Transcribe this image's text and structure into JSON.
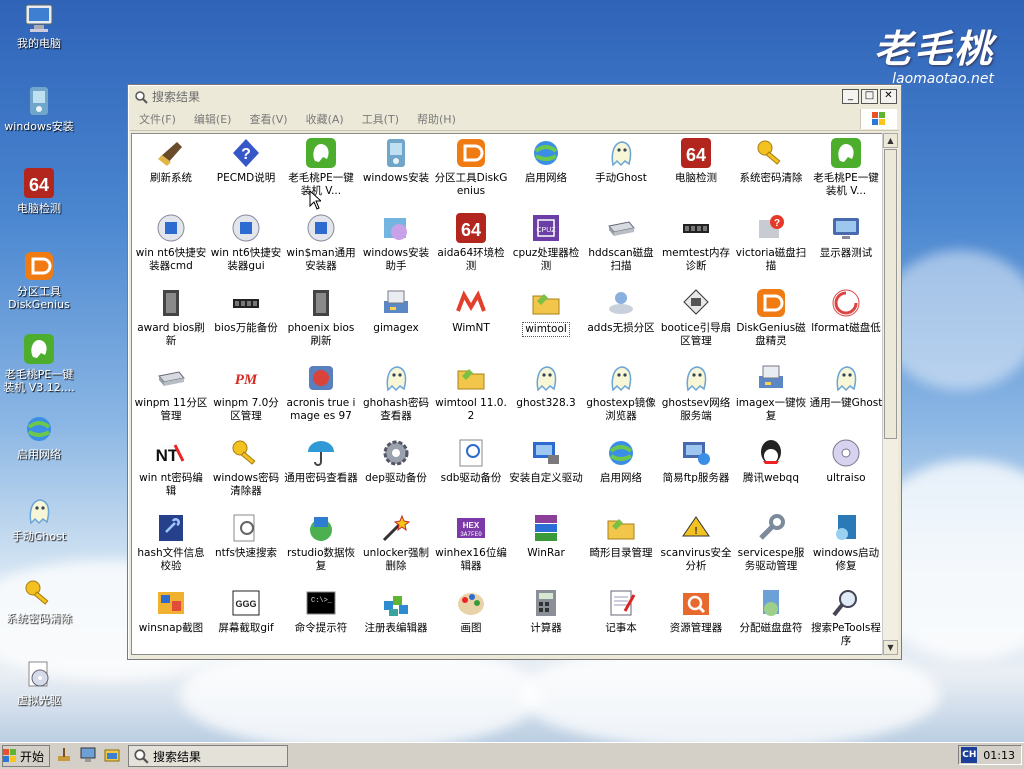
{
  "brand": {
    "name": "老毛桃",
    "url": "laomaotao.net"
  },
  "desktop_icons": [
    {
      "label": "我的电脑",
      "icon": "computer-icon"
    },
    {
      "label": "windows安装",
      "icon": "windows-install-icon"
    },
    {
      "label": "电脑检测",
      "icon": "64-icon"
    },
    {
      "label": "分区工具\nDiskGenius",
      "icon": "diskgenius-icon"
    },
    {
      "label": "老毛桃PE一键\n装机 V3.12....",
      "icon": "laomaotao-icon"
    },
    {
      "label": "启用网络",
      "icon": "network-icon"
    },
    {
      "label": "手动Ghost",
      "icon": "ghost-icon"
    },
    {
      "label": "系统密码清除",
      "icon": "key-icon"
    },
    {
      "label": "虚拟光驱",
      "icon": "virtual-drive-icon"
    }
  ],
  "window": {
    "title": "搜索结果",
    "menu": [
      "文件(F)",
      "编辑(E)",
      "查看(V)",
      "收藏(A)",
      "工具(T)",
      "帮助(H)"
    ],
    "items": [
      {
        "label": "刷新系统",
        "icon": "broom-icon"
      },
      {
        "label": "PECMD说明",
        "icon": "help-icon"
      },
      {
        "label": "老毛桃PE一键装机 V...",
        "icon": "laomaotao-icon"
      },
      {
        "label": "windows安装",
        "icon": "windows-install-icon"
      },
      {
        "label": "分区工具DiskGenius",
        "icon": "diskgenius-icon"
      },
      {
        "label": "启用网络",
        "icon": "network-icon"
      },
      {
        "label": "手动Ghost",
        "icon": "ghost-icon"
      },
      {
        "label": "电脑检测",
        "icon": "64-icon"
      },
      {
        "label": "系统密码清除",
        "icon": "key-icon"
      },
      {
        "label": "老毛桃PE一键装机 V...",
        "icon": "laomaotao-icon"
      },
      {
        "label": "win nt6快捷安装器cmd",
        "icon": "install-cmd-icon"
      },
      {
        "label": "win nt6快捷安装器gui",
        "icon": "install-gui-icon"
      },
      {
        "label": "win$man通用安装器",
        "icon": "winsman-icon"
      },
      {
        "label": "windows安装助手",
        "icon": "install-helper-icon"
      },
      {
        "label": "aida64环境检测",
        "icon": "64-icon"
      },
      {
        "label": "cpuz处理器检测",
        "icon": "cpuz-icon"
      },
      {
        "label": "hddscan磁盘扫描",
        "icon": "hdd-icon"
      },
      {
        "label": "memtest内存诊断",
        "icon": "memory-icon"
      },
      {
        "label": "victoria磁盘扫描",
        "icon": "victoria-icon"
      },
      {
        "label": "显示器测试",
        "icon": "monitor-icon"
      },
      {
        "label": "award bios刷新",
        "icon": "bios-icon"
      },
      {
        "label": "bios万能备份",
        "icon": "chip-icon"
      },
      {
        "label": "phoenix bios刷新",
        "icon": "bios-icon"
      },
      {
        "label": "gimagex",
        "icon": "gimagex-icon"
      },
      {
        "label": "WimNT",
        "icon": "wimnt-icon"
      },
      {
        "label": "wimtool",
        "icon": "folder-icon"
      },
      {
        "label": "adds无损分区",
        "icon": "partition-icon"
      },
      {
        "label": "bootice引导扇区管理",
        "icon": "bootice-icon"
      },
      {
        "label": "DiskGenius磁盘精灵",
        "icon": "diskgenius-icon"
      },
      {
        "label": "lformat磁盘低",
        "icon": "lformat-icon"
      },
      {
        "label": "winpm 11分区管理",
        "icon": "drive-icon"
      },
      {
        "label": "winpm 7.0分区管理",
        "icon": "pm-icon"
      },
      {
        "label": "acronis true image es 97",
        "icon": "acronis-icon"
      },
      {
        "label": "ghohash密码查看器",
        "icon": "ghost-icon"
      },
      {
        "label": "wimtool 11.0.2",
        "icon": "folder-icon"
      },
      {
        "label": "ghost328.3",
        "icon": "ghost-icon"
      },
      {
        "label": "ghostexp镜像浏览器",
        "icon": "ghost-icon"
      },
      {
        "label": "ghostsev网络服务端",
        "icon": "ghost-icon"
      },
      {
        "label": "imagex一键恢复",
        "icon": "imagex-icon"
      },
      {
        "label": "通用一键Ghost",
        "icon": "ghost-icon"
      },
      {
        "label": "win nt密码编辑",
        "icon": "nt-icon"
      },
      {
        "label": "windows密码清除器",
        "icon": "key-icon"
      },
      {
        "label": "通用密码查看器",
        "icon": "umbrella-icon"
      },
      {
        "label": "dep驱动备份",
        "icon": "gear-icon"
      },
      {
        "label": "sdb驱动备份",
        "icon": "sdb-icon"
      },
      {
        "label": "安装自定义驱动",
        "icon": "driver-icon"
      },
      {
        "label": "启用网络",
        "icon": "network-icon"
      },
      {
        "label": "简易ftp服务器",
        "icon": "ftp-icon"
      },
      {
        "label": "腾讯webqq",
        "icon": "qq-icon"
      },
      {
        "label": "ultraiso",
        "icon": "cd-icon"
      },
      {
        "label": "hash文件信息校验",
        "icon": "hash-icon"
      },
      {
        "label": "ntfs快速搜索",
        "icon": "search-doc-icon"
      },
      {
        "label": "rstudio数据恢复",
        "icon": "rstudio-icon"
      },
      {
        "label": "unlocker强制删除",
        "icon": "wand-icon"
      },
      {
        "label": "winhex16位编辑器",
        "icon": "hex-icon"
      },
      {
        "label": "WinRar",
        "icon": "winrar-icon"
      },
      {
        "label": "畸形目录管理",
        "icon": "folder-icon"
      },
      {
        "label": "scanvirus安全分析",
        "icon": "scan-icon"
      },
      {
        "label": "servicespe服务驱动管理",
        "icon": "wrench-icon"
      },
      {
        "label": "windows启动修复",
        "icon": "repair-icon"
      },
      {
        "label": "winsnap截图",
        "icon": "winsnap-icon"
      },
      {
        "label": "屏幕截取gif",
        "icon": "gif-icon"
      },
      {
        "label": "命令提示符",
        "icon": "cmd-icon"
      },
      {
        "label": "注册表编辑器",
        "icon": "registry-icon"
      },
      {
        "label": "画图",
        "icon": "paint-icon"
      },
      {
        "label": "计算器",
        "icon": "calculator-icon"
      },
      {
        "label": "记事本",
        "icon": "notepad-icon"
      },
      {
        "label": "资源管理器",
        "icon": "explorer-icon"
      },
      {
        "label": "分配磁盘盘符",
        "icon": "assign-drive-icon"
      },
      {
        "label": "搜索PeTools程序",
        "icon": "magnifier-icon"
      }
    ]
  },
  "taskbar": {
    "start_label": "开始",
    "task_label": "搜索结果",
    "ime": "CH",
    "clock": "01:13"
  },
  "colors": {
    "desktop_sky": "#4a86d0",
    "window_bg": "#ece9d8",
    "taskbar": "#d4d0c8"
  }
}
